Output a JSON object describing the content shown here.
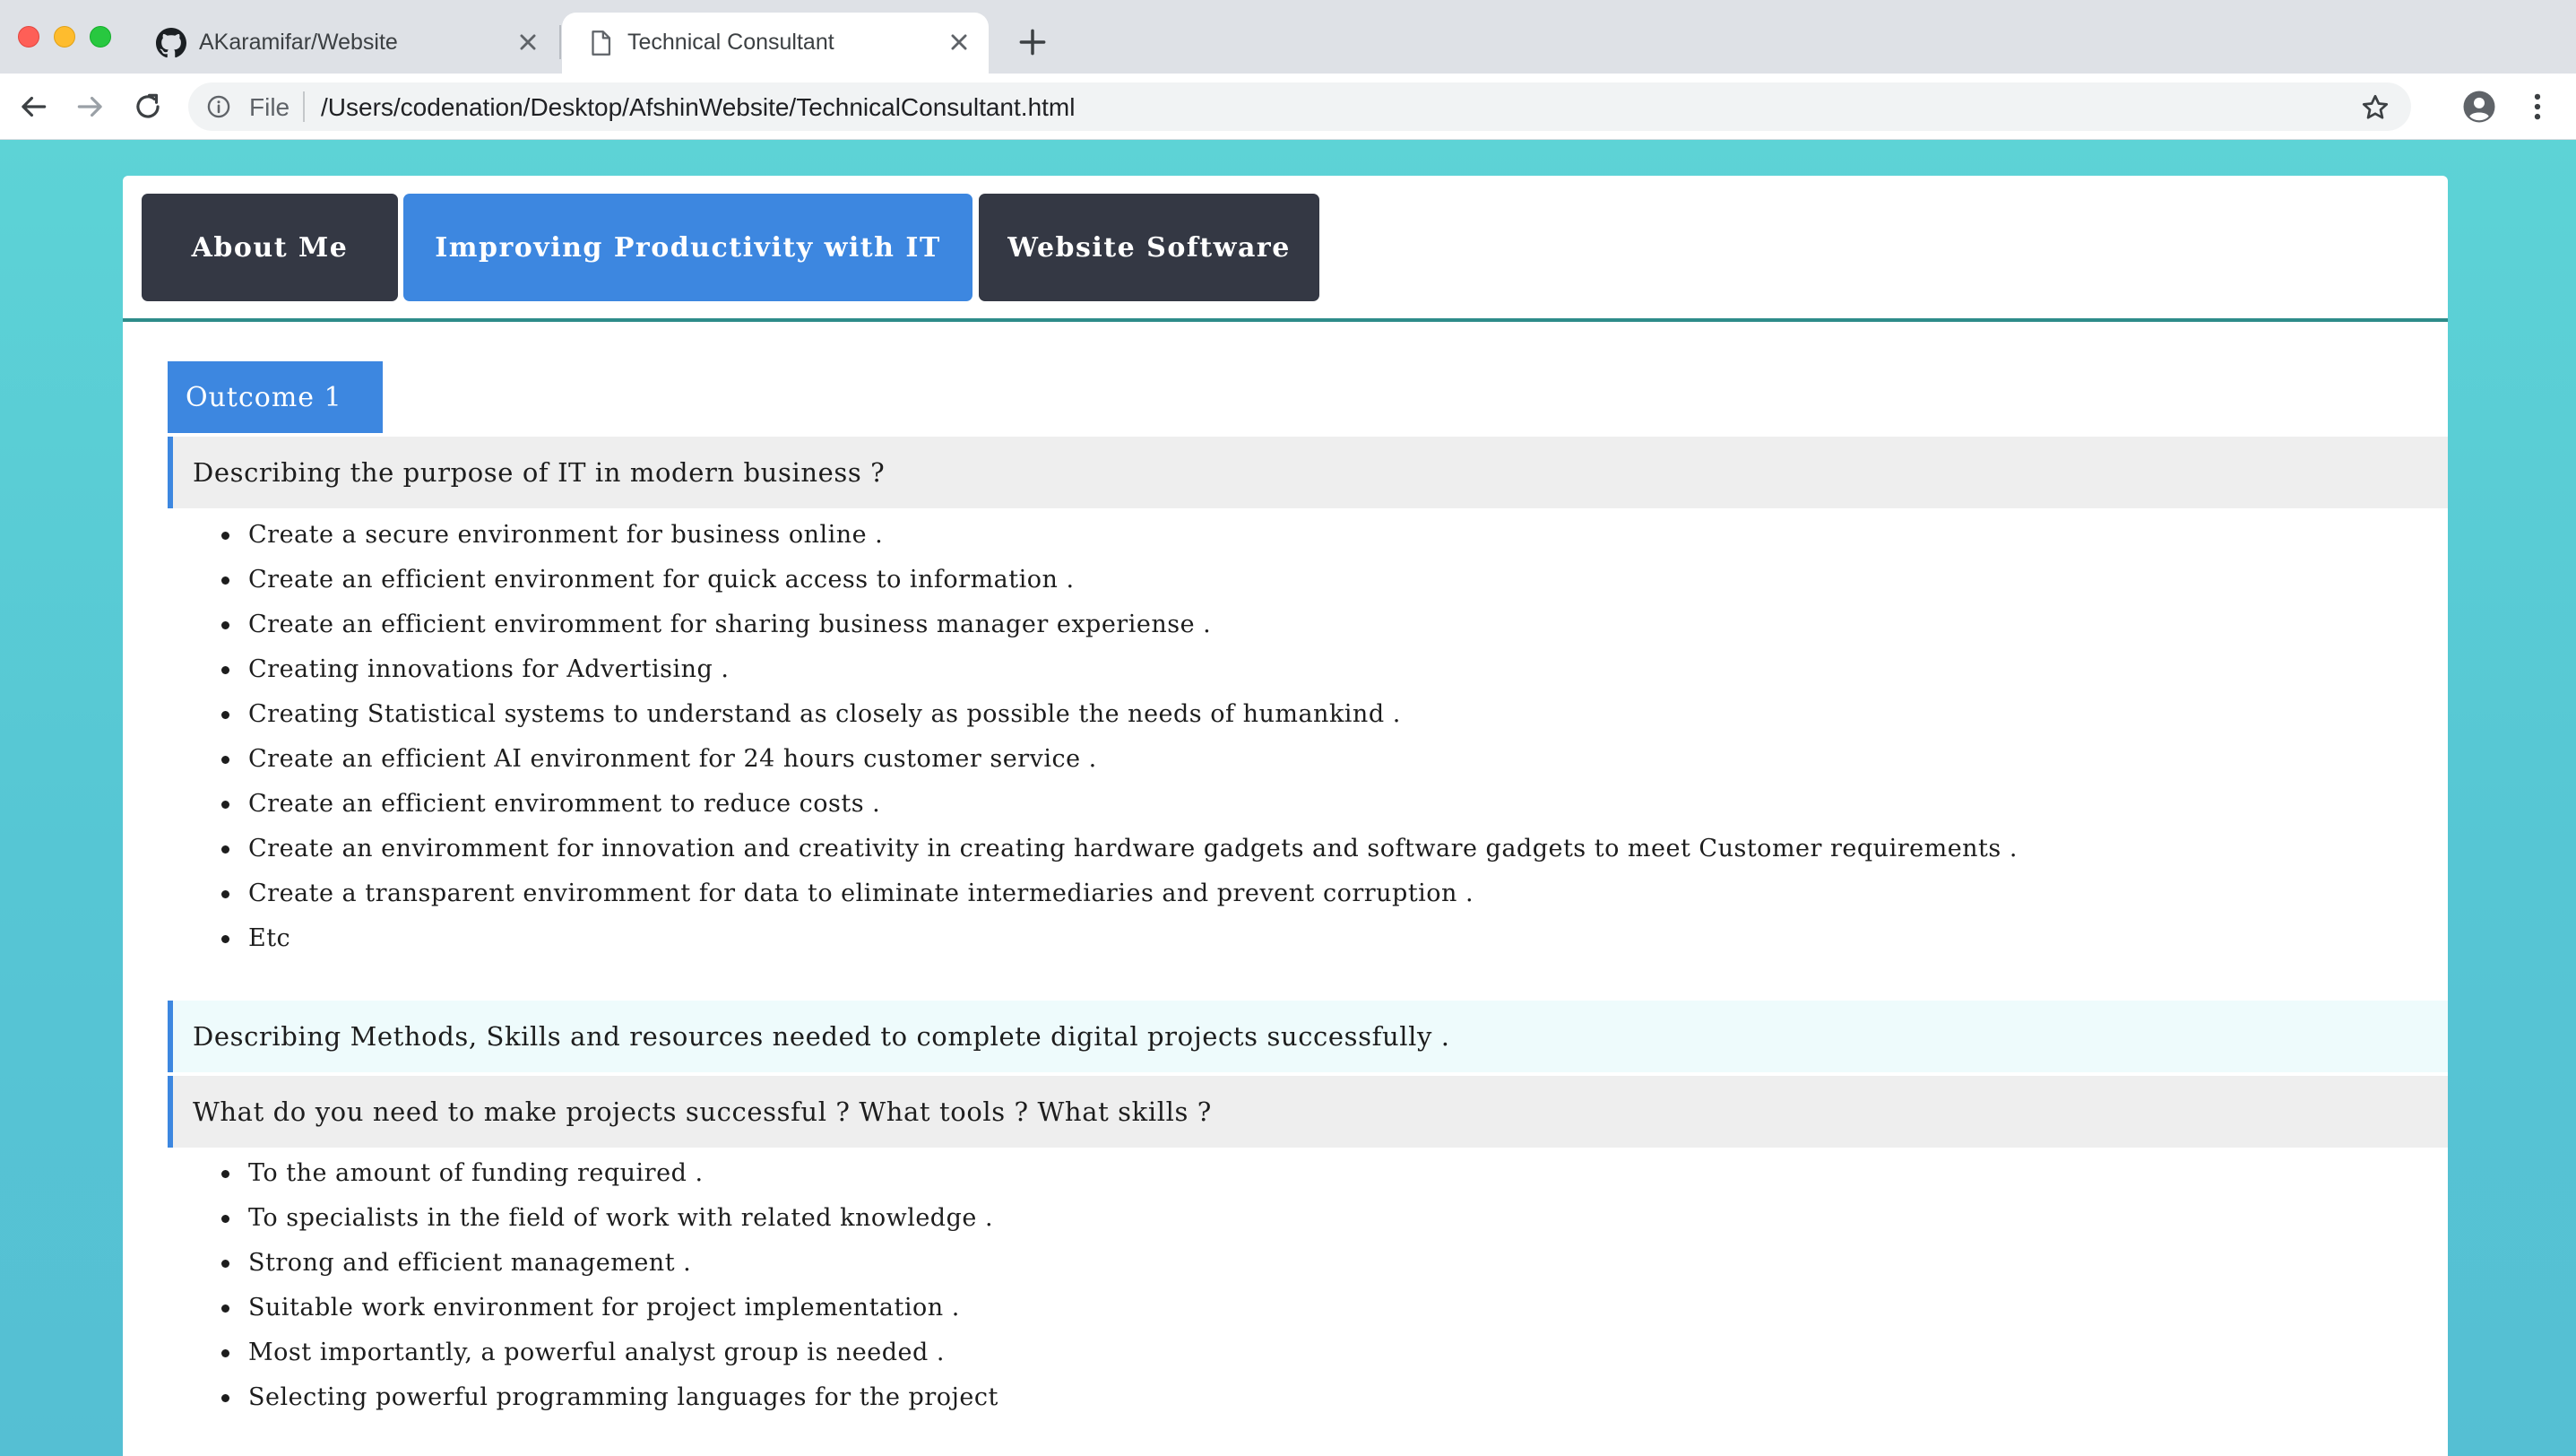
{
  "browser": {
    "tabs": [
      {
        "title": "AKaramifar/Website",
        "icon": "github-icon",
        "active": false
      },
      {
        "title": "Technical Consultant",
        "icon": "document-icon",
        "active": true
      }
    ],
    "address": {
      "scheme_label": "File",
      "url": "/Users/codenation/Desktop/AfshinWebsite/TechnicalConsultant.html"
    }
  },
  "nav": {
    "items": [
      {
        "label": "About Me",
        "active": false
      },
      {
        "label": "Improving Productivity with IT",
        "active": true
      },
      {
        "label": "Website Software",
        "active": false
      }
    ]
  },
  "content": {
    "outcome_label": "Outcome 1",
    "section1": {
      "heading": "Describing the purpose of IT in modern business ?",
      "items": [
        "Create a secure environment for business online .",
        "Create an efficient environment for quick access to information .",
        "Create an efficient enviromment for sharing business manager experiense .",
        "Creating innovations for Advertising .",
        "Creating Statistical systems to understand as closely as possible the needs of humankind .",
        "Create an efficient AI environment for 24 hours customer service .",
        "Create an efficient enviromment to reduce costs .",
        "Create an enviromment for innovation and creativity in creating hardware gadgets and software gadgets to meet Customer requirements .",
        "Create a transparent enviromment for data to eliminate intermediaries and prevent corruption .",
        "Etc"
      ]
    },
    "section2": {
      "heading": "Describing Methods, Skills and resources needed to complete digital projects successfully .",
      "subheading": "What do you need to make projects successful ? What tools ? What skills ?",
      "items": [
        "To the amount of funding required .",
        "To specialists in the field of work with related knowledge .",
        "Strong and efficient management .",
        "Suitable work environment for project implementation .",
        "Most importantly, a powerful analyst group is needed .",
        "Selecting powerful programming languages for the project"
      ]
    }
  },
  "colors": {
    "nav_dark": "#343844",
    "accent_blue": "#3d87e0",
    "background_teal": "#5dd3d6"
  }
}
